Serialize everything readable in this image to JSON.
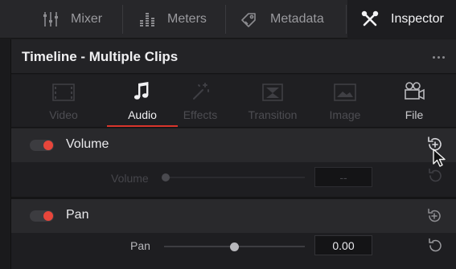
{
  "topbar": {
    "mixer": "Mixer",
    "meters": "Meters",
    "metadata": "Metadata",
    "inspector": "Inspector"
  },
  "panel": {
    "title": "Timeline - Multiple Clips"
  },
  "tabs": [
    {
      "label": "Video",
      "state": "disabled"
    },
    {
      "label": "Audio",
      "state": "active"
    },
    {
      "label": "Effects",
      "state": "disabled"
    },
    {
      "label": "Transition",
      "state": "disabled"
    },
    {
      "label": "Image",
      "state": "disabled"
    },
    {
      "label": "File",
      "state": "enabled"
    }
  ],
  "volume": {
    "title": "Volume",
    "enabled": true,
    "row_label": "Volume",
    "value": "--",
    "state": "disabled"
  },
  "pan": {
    "title": "Pan",
    "enabled": true,
    "row_label": "Pan",
    "value": "0.00",
    "slider_position": 0.5
  },
  "colors": {
    "accent": "#e8463b",
    "tab_underline": "#d9352c",
    "background": "#1b1b1d"
  }
}
